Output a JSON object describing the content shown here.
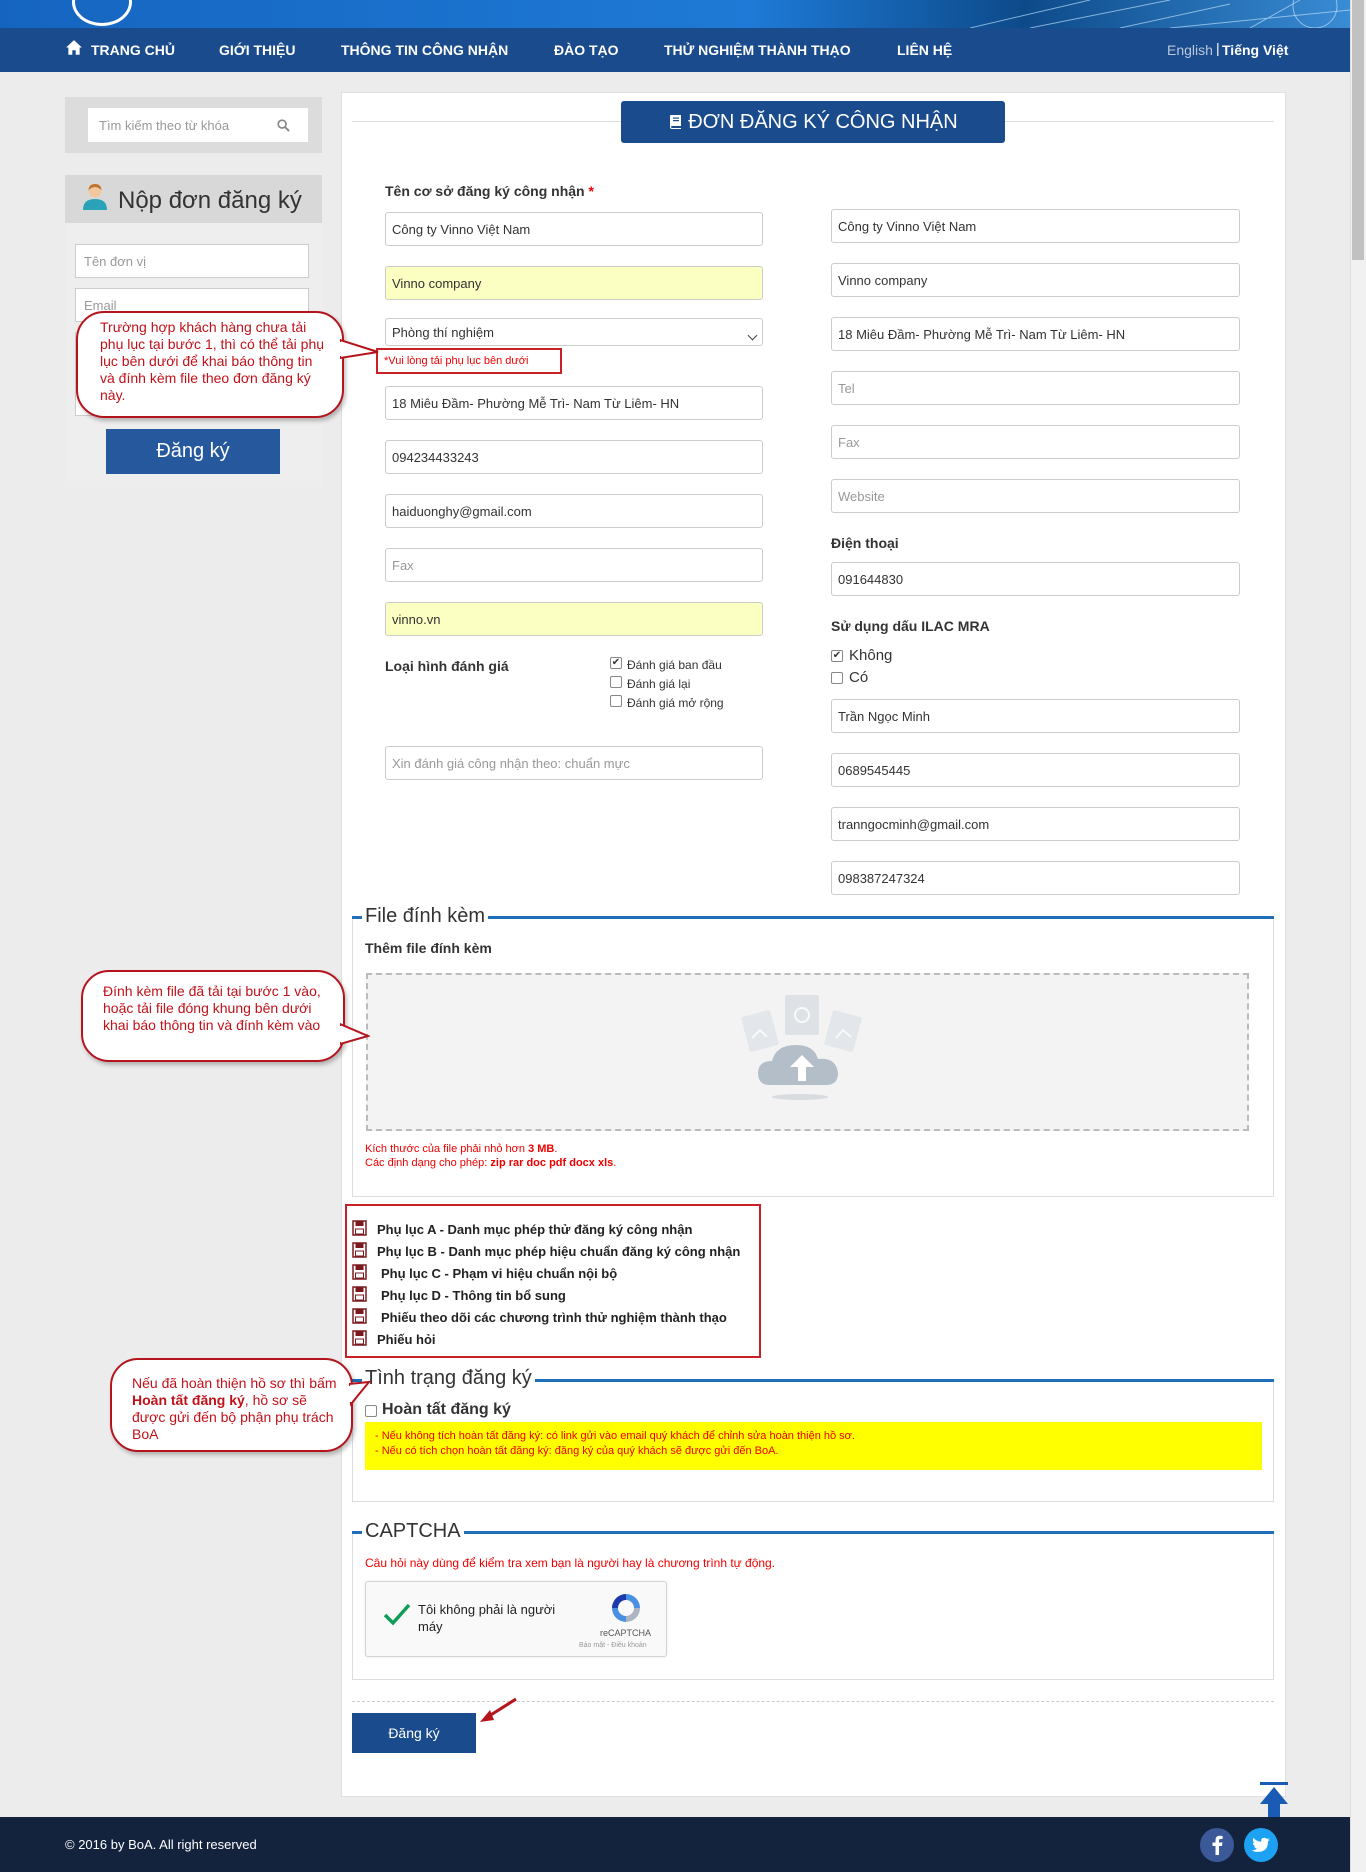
{
  "nav": {
    "items": [
      "TRANG CHỦ",
      "GIỚI THIỆU",
      "THÔNG TIN CÔNG NHẬN",
      "ĐÀO TẠO",
      "THỬ NGHIỆM THÀNH THẠO",
      "LIÊN HỆ"
    ],
    "lang_en": "English",
    "lang_sep": "|",
    "lang_vi": "Tiếng Việt"
  },
  "sidebar": {
    "search_placeholder": "Tìm kiếm theo từ khóa",
    "panel_title": "Nộp đơn đăng ký",
    "unit_placeholder": "Tên đơn vị",
    "email_placeholder": "Email",
    "submit_label": "Đăng ký"
  },
  "form": {
    "title": "ĐƠN ĐĂNG KÝ CÔNG NHẬN",
    "facility_label": "Tên cơ sở đăng ký công nhận",
    "required_mark": "*",
    "left": {
      "name_vi": "Công ty Vinno Việt Nam",
      "name_en": "Vinno company",
      "type_select": "Phòng thí nghiệm",
      "upload_warning": "*Vui lòng tải phụ lục bên dưới",
      "address": "18 Miêu Đầm- Phường Mễ Trì- Nam Từ Liêm- HN",
      "phone": "094234433243",
      "email": "haiduonghy@gmail.com",
      "fax_placeholder": "Fax",
      "website": "vinno.vn",
      "standard_placeholder": "Xin đánh giá công nhận theo: chuẩn mực"
    },
    "right": {
      "name_vi": "Công ty Vinno Việt Nam",
      "name_en": "Vinno company",
      "address": "18 Miêu Đầm- Phường Mễ Trì- Nam Từ Liêm- HN",
      "tel_placeholder": "Tel",
      "fax_placeholder": "Fax",
      "website_placeholder": "Website",
      "phone_label": "Điện thoại",
      "phone": "091644830",
      "ilac_label": "Sử dụng dấu ILAC MRA",
      "ilac_options": [
        {
          "label": "Không",
          "checked": true
        },
        {
          "label": "Có",
          "checked": false
        }
      ],
      "contact_name": "Trần Ngọc Minh",
      "contact_phone": "0689545445",
      "contact_email": "tranngocminh@gmail.com",
      "contact_mobile": "098387247324"
    },
    "eval_label": "Loại hình đánh giá",
    "eval_options": [
      {
        "label": "Đánh giá ban đầu",
        "checked": true
      },
      {
        "label": "Đánh giá lại",
        "checked": false
      },
      {
        "label": "Đánh giá mở rộng",
        "checked": false
      }
    ]
  },
  "attachments": {
    "legend": "File đính kèm",
    "subtitle": "Thêm file đính kèm",
    "size_note_prefix": "Kích thước của file phải nhỏ hơn",
    "size_value": "3 MB",
    "size_note_suffix": ".",
    "format_note_prefix": "Các định dạng cho phép:",
    "formats": "zip rar doc pdf docx xls",
    "format_note_suffix": ".",
    "appendices": [
      "Phụ lục A - Danh mục phép thử đăng ký công nhận",
      "Phụ lục B - Danh mục phép hiệu chuẩn đăng ký công nhận",
      "Phụ lục C - Phạm vi hiệu chuẩn nội bộ",
      "Phụ lục D - Thông tin bổ sung",
      "Phiếu theo dõi các chương trình thử nghiệm thành thạo",
      "Phiếu hỏi"
    ]
  },
  "status": {
    "legend": "Tình trạng đăng ký",
    "complete_label": "Hoàn tất đăng ký",
    "notes": [
      "- Nếu không tích hoàn tất đăng ký: có link gửi vào email quý khách để chỉnh sửa hoàn thiện hồ sơ.",
      "- Nếu có tích chọn hoàn tất đăng ký: đăng ký của quý khách sẽ được gửi đến BoA."
    ]
  },
  "captcha": {
    "legend": "CAPTCHA",
    "question": "Câu hỏi này dùng để kiểm tra xem bạn là người hay là chương trình tự động.",
    "checkbox_text": "Tôi không phải là người máy",
    "brand": "reCAPTCHA",
    "terms": "Bảo mật - Điều khoản"
  },
  "submit_label": "Đăng ký",
  "callouts": {
    "appendix_hint": "Trường hợp khách hàng chưa tải phụ lục tại bước 1, thì có thể tải phụ lục bên dưới để khai báo thông tin và đính kèm file theo đơn đăng ký này.",
    "attach_hint": "Đính kèm file đã tải tại bước 1 vào, hoặc tải file đóng khung bên dưới khai báo thông tin và đính kèm vào",
    "complete_hint_prefix": "Nếu đã hoàn thiện hồ sơ thì bấm",
    "complete_hint_bold": "Hoàn tất đăng ký",
    "complete_hint_suffix": ", hồ sơ sẽ được gửi đến bộ phận phụ trách BoA"
  },
  "footer": {
    "copyright": "© 2016 by BoA. All right reserved"
  },
  "icons": {
    "home": "home-icon",
    "search": "search-icon",
    "user": "user-icon",
    "document": "document-icon",
    "upload": "cloud-upload-icon",
    "back_to_top": "arrow-up-icon",
    "facebook": "facebook-icon",
    "twitter": "twitter-icon"
  },
  "colors": {
    "nav_bg": "#1a4b8c",
    "footer_bg": "#13233d",
    "accent_red": "#cc2027",
    "highlight_yellow": "#ffff00",
    "autofill_yellow": "#fbffc2"
  }
}
